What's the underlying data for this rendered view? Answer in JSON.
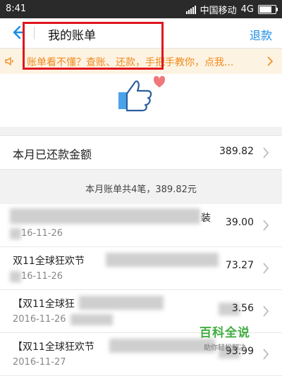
{
  "statusbar": {
    "time": "8:41",
    "carrier": "中国移动",
    "network": "4G",
    "battery_level": 0.75
  },
  "navbar": {
    "back_icon": "back-arrow-icon",
    "title": "我的账单",
    "action_label": "退款"
  },
  "notice": {
    "icon": "speaker-icon",
    "text": "账单看不懂？查账、还款，手把手教你，点我..."
  },
  "hero": {
    "icon": "thumbs-up-heart-icon"
  },
  "summary": {
    "label": "本月已还款金额",
    "amount": "389.82"
  },
  "bills_header": "本月账单共4笔，389.82元",
  "bills": [
    {
      "title": "装",
      "date": "16-11-26",
      "amount": "39.00"
    },
    {
      "title": "双11全球狂欢节",
      "date": "16-11-26",
      "amount": "73.27"
    },
    {
      "title": "【双11全球狂",
      "date": "2016-11-26",
      "amount": "3.56"
    },
    {
      "title": "【双11全球狂欢节",
      "date": "2016-11-27",
      "amount": "93.99"
    }
  ],
  "watermark": {
    "main": "百科全说",
    "sub": "助你轻松解决"
  },
  "colors": {
    "accent": "#1a8ce6",
    "notice": "#f08a1d",
    "highlight": "#e0151f"
  }
}
